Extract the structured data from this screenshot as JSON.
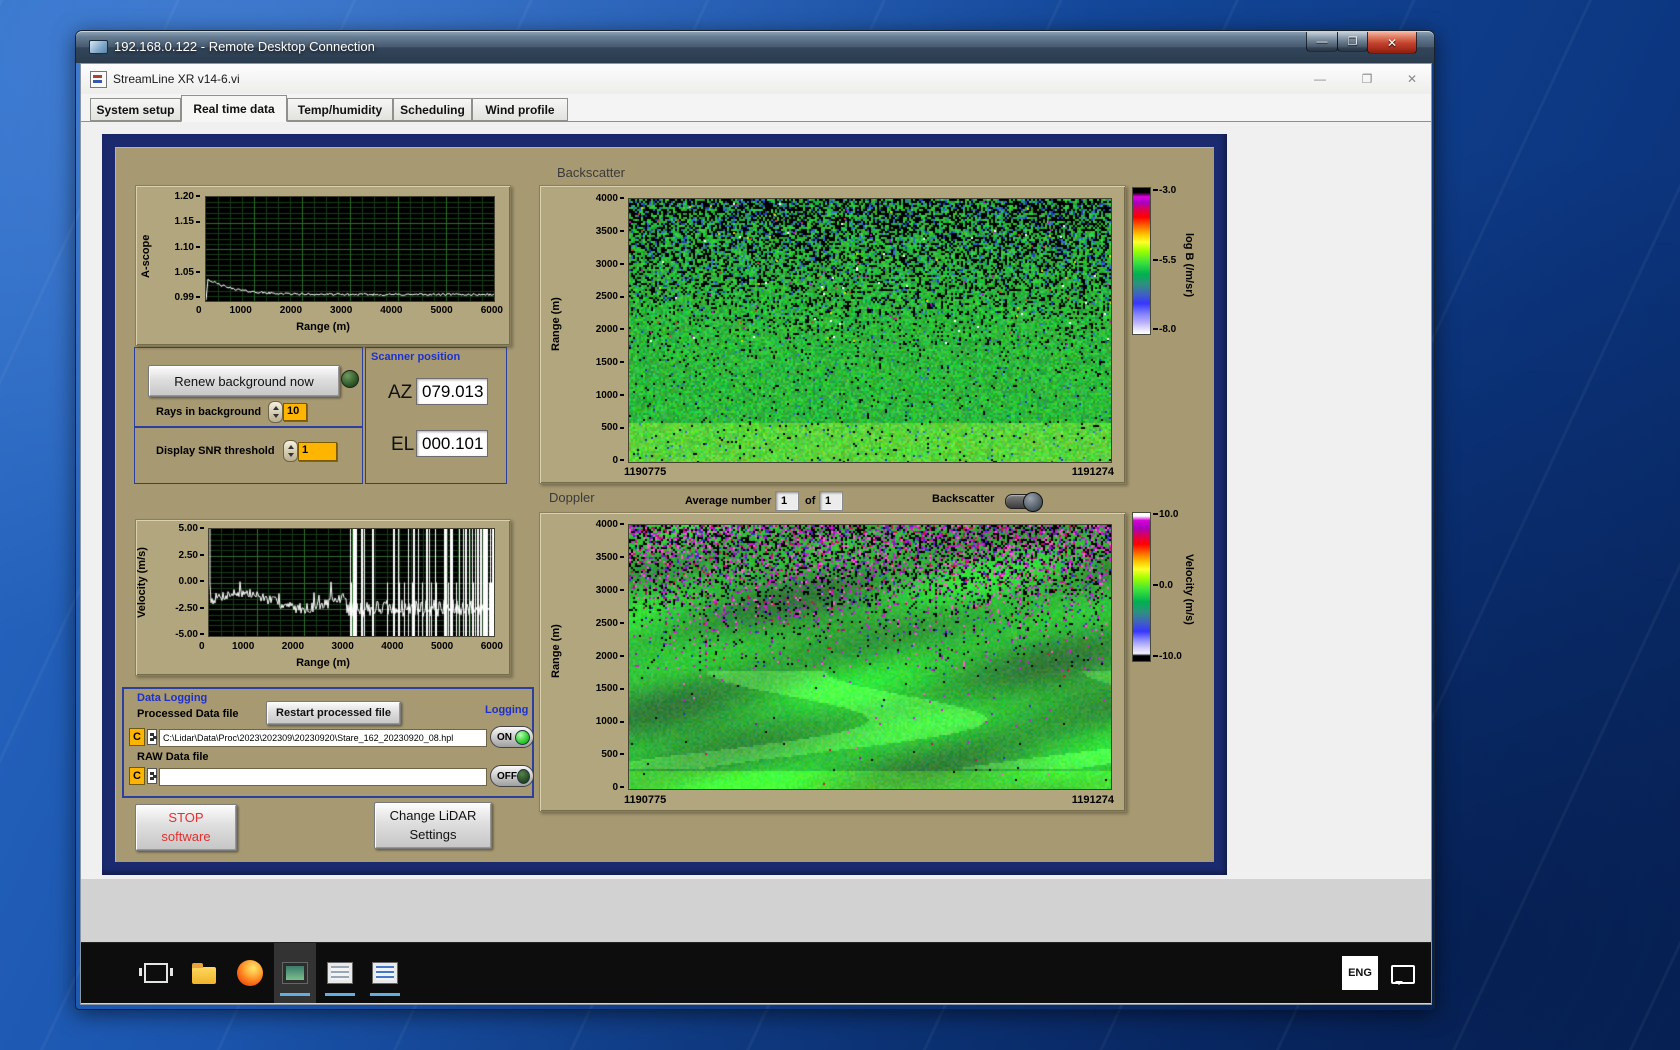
{
  "rdp_window": {
    "title": "192.168.0.122 - Remote Desktop Connection",
    "controls": {
      "minimize": "—",
      "maximize": "❐",
      "close": "✕"
    }
  },
  "app_window": {
    "title": "StreamLine XR v14-6.vi",
    "controls": {
      "minimize": "—",
      "restore": "❐",
      "close": "✕"
    },
    "tabs": [
      {
        "label": "System setup"
      },
      {
        "label": "Real time data"
      },
      {
        "label": "Temp/humidity"
      },
      {
        "label": "Scheduling"
      },
      {
        "label": "Wind profile"
      }
    ]
  },
  "ascope": {
    "ylabel": "A-scope",
    "xlabel": "Range (m)",
    "yticks": [
      "1.20",
      "1.15",
      "1.10",
      "1.05",
      "0.99"
    ],
    "xticks": [
      "0",
      "1000",
      "2000",
      "3000",
      "4000",
      "5000",
      "6000"
    ]
  },
  "background_controls": {
    "renew_button": "Renew background now",
    "rays_label": "Rays in background",
    "rays_value": "10",
    "snr_label": "Display SNR threshold",
    "snr_value": "1"
  },
  "scanner_position": {
    "title": "Scanner position",
    "az_label": "AZ",
    "az_value": "079.013",
    "el_label": "EL",
    "el_value": "000.101"
  },
  "velocity_plot": {
    "ylabel": "Velocity (m/s)",
    "xlabel": "Range (m)",
    "yticks": [
      "5.00",
      "2.50",
      "0.00",
      "-2.50",
      "-5.00"
    ],
    "xticks": [
      "0",
      "1000",
      "2000",
      "3000",
      "4000",
      "5000",
      "6000"
    ]
  },
  "data_logging": {
    "title": "Data Logging",
    "processed_label": "Processed Data file",
    "restart_button": "Restart processed file",
    "logging_label": "Logging",
    "drive_letter": "C",
    "processed_path": "C:\\Lidar\\Data\\Proc\\2023\\202309\\20230920\\Stare_162_20230920_08.hpl",
    "raw_label": "RAW Data file",
    "raw_path": "",
    "on_label": "ON",
    "off_label": "OFF"
  },
  "stop_button": {
    "line1": "STOP",
    "line2": "software"
  },
  "change_button": {
    "line1": "Change LiDAR",
    "line2": "Settings"
  },
  "backscatter": {
    "title": "Backscatter",
    "ylabel": "Range (m)",
    "yticks": [
      "4000",
      "3500",
      "3000",
      "2500",
      "2000",
      "1500",
      "1000",
      "500",
      "0"
    ],
    "x_start": "1190775",
    "x_end": "1191274",
    "colorbar_label": "log B (/m/sr)",
    "colorbar_ticks": [
      "-3.0",
      "-5.5",
      "-8.0"
    ]
  },
  "doppler": {
    "title": "Doppler",
    "avg_label": "Average number",
    "avg_value": "1",
    "of_label": "of",
    "of_count": "1",
    "toggle_label": "Backscatter",
    "ylabel": "Range (m)",
    "yticks": [
      "4000",
      "3500",
      "3000",
      "2500",
      "2000",
      "1500",
      "1000",
      "500",
      "0"
    ],
    "x_start": "1190775",
    "x_end": "1191274",
    "colorbar_label": "Velocity (m/s)",
    "colorbar_ticks": [
      "10.0",
      "0.0",
      "-10.0"
    ]
  },
  "taskbar": {
    "language": "ENG"
  },
  "chart_data": [
    {
      "type": "line",
      "title": "A-scope",
      "xlabel": "Range (m)",
      "ylabel": "A-scope",
      "xlim": [
        0,
        6000
      ],
      "ylim": [
        0.99,
        1.2
      ],
      "series": [
        {
          "name": "A-scope",
          "points": [
            [
              0,
              0.99
            ],
            [
              80,
              1.035
            ],
            [
              150,
              1.03
            ],
            [
              300,
              1.025
            ],
            [
              500,
              1.018
            ],
            [
              700,
              1.013
            ],
            [
              900,
              1.012
            ],
            [
              1200,
              1.008
            ],
            [
              1500,
              1.006
            ],
            [
              2000,
              1.006
            ],
            [
              2500,
              1.005
            ],
            [
              3000,
              1.006
            ],
            [
              3500,
              1.005
            ],
            [
              4000,
              1.006
            ],
            [
              4500,
              1.005
            ],
            [
              5000,
              1.006
            ],
            [
              5500,
              1.005
            ],
            [
              6000,
              1.006
            ]
          ]
        }
      ],
      "notes": "white trace on black plot with green grid; sharp peak near range 0 decaying to ~1.0"
    },
    {
      "type": "line",
      "title": "Velocity",
      "xlabel": "Range (m)",
      "ylabel": "Velocity (m/s)",
      "xlim": [
        0,
        6000
      ],
      "ylim": [
        -5,
        5
      ],
      "series": [
        {
          "name": "Velocity",
          "points": [
            [
              0,
              0
            ],
            [
              200,
              -1.0
            ],
            [
              400,
              -1.5
            ],
            [
              600,
              -1.2
            ],
            [
              800,
              -1.8
            ],
            [
              1000,
              -2.2
            ],
            [
              1200,
              -1.9
            ],
            [
              1400,
              -2.3
            ],
            [
              1600,
              -2.5
            ],
            [
              1800,
              -2.2
            ],
            [
              2000,
              -2.0
            ],
            [
              2200,
              -1.8
            ],
            [
              2400,
              -0.3
            ],
            [
              2600,
              -1.7
            ],
            [
              2800,
              -2.4
            ]
          ]
        }
      ],
      "notes": "beyond ~2900 m the trace saturates in full-scale ±5 m/s noise spikes"
    },
    {
      "type": "heatmap",
      "title": "Backscatter",
      "x_range_labels": [
        "1190775",
        "1191274"
      ],
      "ylabel": "Range (m)",
      "ylim": [
        0,
        4000
      ],
      "colorbar": {
        "label": "log B (/m/sr)",
        "min": -8.0,
        "max": -3.0
      },
      "notes": "mostly green (~ -5.5) below 2000 m; increasing black/blue speckle noise above 2500 m"
    },
    {
      "type": "heatmap",
      "title": "Doppler",
      "x_range_labels": [
        "1190775",
        "1191274"
      ],
      "ylabel": "Range (m)",
      "ylim": [
        0,
        4000
      ],
      "colorbar": {
        "label": "Velocity (m/s)",
        "min": -10.0,
        "max": 10.0
      },
      "notes": "smooth green (~0 m/s) below 1500 m with brighter wisps; dense black/magenta speckle noise above 2000 m"
    }
  ]
}
